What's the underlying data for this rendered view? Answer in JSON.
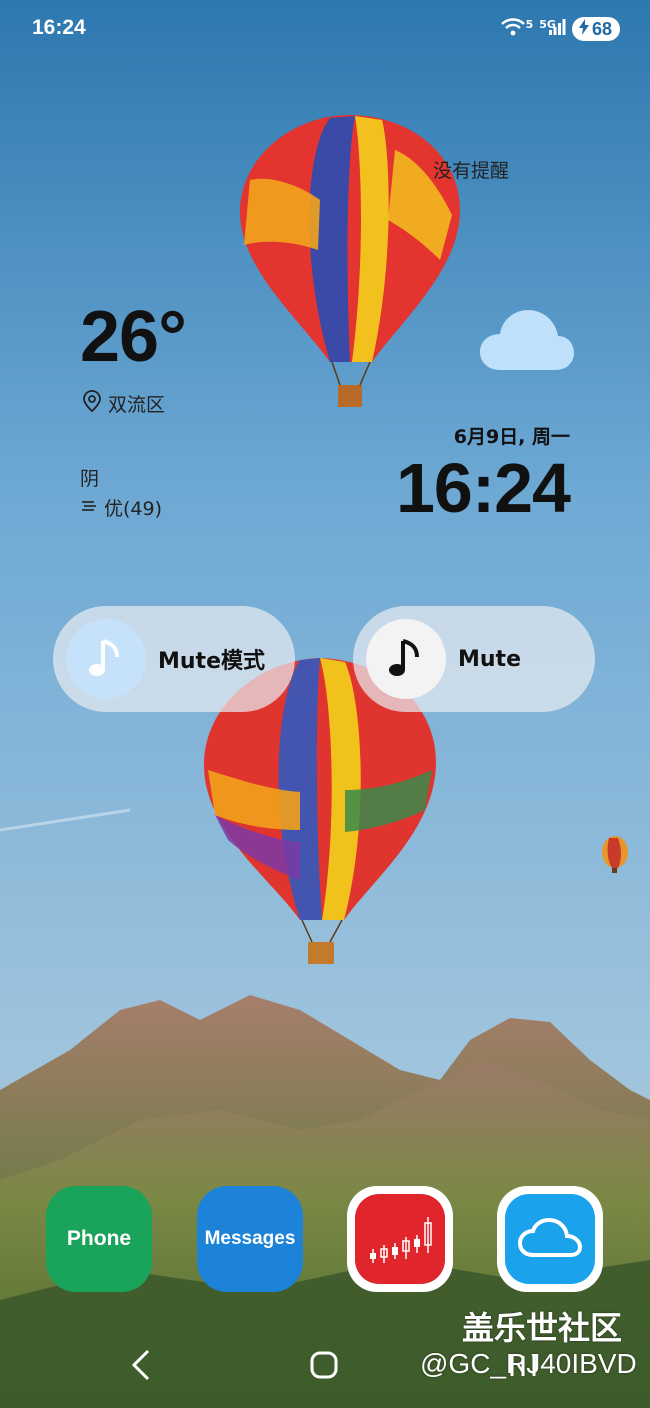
{
  "status_bar": {
    "time": "16:24",
    "network": "5G",
    "wifi_badge": "5",
    "battery": "68",
    "icons": [
      "wifi-icon",
      "signal-icon",
      "charging-icon"
    ]
  },
  "widget": {
    "reminder_text": "没有提醒",
    "temperature": "26°",
    "location": "双流区",
    "date": "6月9日, 周一",
    "time": "16:24",
    "condition": "阴",
    "air_quality": "优(49)",
    "weather_icon": "cloud-icon"
  },
  "mute_pills": [
    {
      "label": "Mute模式",
      "icon": "music-note-icon"
    },
    {
      "label": "Mute",
      "icon": "music-note-icon"
    }
  ],
  "dock": [
    {
      "name": "Phone",
      "label": "Phone",
      "color": "#1aa35a"
    },
    {
      "name": "Messages",
      "label": "Messages",
      "color": "#1c83d9"
    },
    {
      "name": "Stocks",
      "icon": "candlestick-chart-icon",
      "color": "#e0262c"
    },
    {
      "name": "Cloud",
      "icon": "cloud-icon",
      "color": "#1aa3ea"
    }
  ],
  "nav": [
    "back-icon",
    "home-icon",
    "recent-apps-icon"
  ],
  "watermark": {
    "line1": "盖乐世社区",
    "line2": "@GC_RJ40IBVD"
  }
}
